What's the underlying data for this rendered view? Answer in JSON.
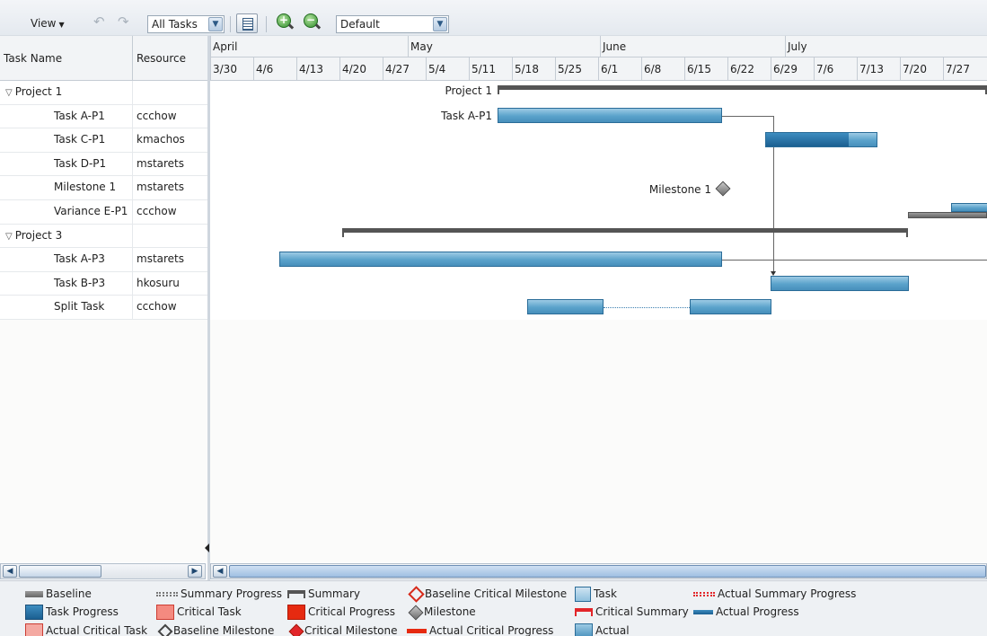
{
  "toolbar": {
    "view_label": "View",
    "filter_select": "All Tasks",
    "layout_select": "Default"
  },
  "table": {
    "headers": {
      "task_name": "Task Name",
      "resource": "Resource"
    },
    "rows": [
      {
        "name": "Project 1",
        "resource": "",
        "expanded": true
      },
      {
        "name": "Task A-P1",
        "resource": "ccchow"
      },
      {
        "name": "Task C-P1",
        "resource": "kmachos"
      },
      {
        "name": "Task D-P1",
        "resource": "mstarets"
      },
      {
        "name": "Milestone 1",
        "resource": "mstarets"
      },
      {
        "name": "Variance E-P1",
        "resource": "ccchow"
      },
      {
        "name": "Project 3",
        "resource": "",
        "expanded": true
      },
      {
        "name": "Task A-P3",
        "resource": "mstarets"
      },
      {
        "name": "Task B-P3",
        "resource": "hkosuru"
      },
      {
        "name": "Split Task",
        "resource": "ccchow"
      }
    ]
  },
  "timeline": {
    "months": [
      "April",
      "May",
      "June",
      "July"
    ],
    "weeks": [
      "3/30",
      "4/6",
      "4/13",
      "4/20",
      "4/27",
      "5/4",
      "5/11",
      "5/18",
      "5/25",
      "6/1",
      "6/8",
      "6/15",
      "6/22",
      "6/29",
      "7/6",
      "7/13",
      "7/20",
      "7/27"
    ]
  },
  "gantt": {
    "labels": {
      "project1": "Project 1",
      "task_a_p1": "Task A-P1",
      "milestone1": "Milestone 1"
    },
    "task_c_p1_progress_percent": 75
  },
  "legend": {
    "items": [
      "Baseline",
      "Summary Progress",
      "Summary",
      "Baseline Critical Milestone",
      "Task",
      "Actual Summary Progress",
      "Task Progress",
      "Critical Task",
      "Critical Progress",
      "Milestone",
      "Critical Summary",
      "Actual Progress",
      "Actual Critical Task",
      "Baseline Milestone",
      "Critical Milestone",
      "Actual Critical Progress",
      "Actual"
    ]
  },
  "colors": {
    "task": "#5aa2cb",
    "progress": "#1b5f91",
    "summary": "#555555",
    "critical": "#e62a10"
  }
}
